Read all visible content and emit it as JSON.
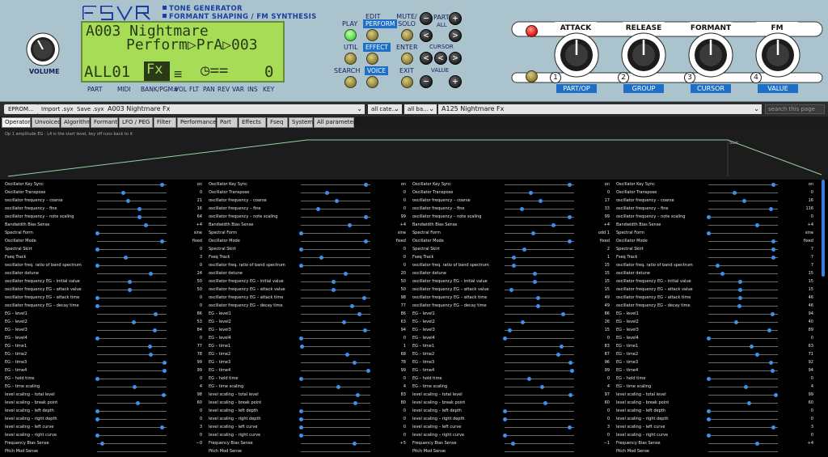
{
  "panel": {
    "logo": "FSVR",
    "subtitle1": "TONE GENERATOR",
    "subtitle2": "FORMANT SHAPING / FM  SYNTHESIS",
    "volume_label": "VOLUME",
    "lcd": {
      "line1": "A003 Nightmare",
      "line2": "Perform▷PrA▷003",
      "part": "ALL01",
      "fx": "Fx",
      "bars": "≡",
      "clock": "◷==",
      "key": "0"
    },
    "lcd_labels": [
      "PART",
      "MIDI",
      "BANK/PGM#",
      "VOL",
      "FLT",
      "PAN",
      "REV",
      "VAR",
      "INS",
      "KEY"
    ],
    "buttons": {
      "play": "PLAY",
      "edit": "EDIT",
      "perform": "PERFORM",
      "util": "UTIL",
      "effect": "EFFECT",
      "search": "SEARCH",
      "voice": "VOICE",
      "mute_solo": "MUTE/\nSOLO",
      "enter": "ENTER",
      "exit": "EXIT",
      "part": "PART",
      "all": "ALL",
      "cursor": "CURSOR",
      "value": "VALUE",
      "minus": "−",
      "plus": "+",
      "lt": "<",
      "gt": ">"
    },
    "knobs": [
      {
        "label": "ATTACK",
        "num": "1",
        "bottom": "PART/OP"
      },
      {
        "label": "RELEASE",
        "num": "2",
        "bottom": "GROUP"
      },
      {
        "label": "FORMANT",
        "num": "3",
        "bottom": "CURSOR"
      },
      {
        "label": "FM",
        "num": "4",
        "bottom": "VALUE"
      }
    ],
    "colors": {
      "panel": "#abc3cc",
      "lcd": "#a7dc56",
      "accent": "#1e6fc8"
    }
  },
  "toolbar": {
    "eprom": "EPROM...",
    "import": "Import .syx",
    "save": "Save .syx",
    "program": "A003  Nightmare  Fx",
    "category": "all cate...",
    "bank": "all ba...",
    "preset": "A125  Nightmare  Fx",
    "search_placeholder": "search this page"
  },
  "tabs": [
    "Operators",
    "Unvoiced",
    "Algorithm",
    "Formant",
    "LFO / PEG",
    "Filter",
    "Performance",
    "Part",
    "Effects",
    "Fseq",
    "System",
    "All parameters"
  ],
  "active_tab": "Operators",
  "eg": {
    "title": "Op 1 amplitude EG : L4 is the start level, key off runs back to it",
    "sustain_label": "Sust"
  },
  "param_names": [
    "Oscillator Key Sync",
    "Oscillator Transpose",
    "oscillator frequency – coarse",
    "oscillator frequency – fine",
    "oscillator frequency – note scaling",
    "Bandwidth Bias Sense",
    "Spectral Form",
    "Oscillator Mode",
    "Spectral Skirt",
    "Fseq Track",
    "oscillator freq. ratio of band spectrum",
    "oscillator detune",
    "oscillator frequency EG – initial value",
    "oscillator frequency EG – attack value",
    "oscillator frequency EG – attack time",
    "oscillator frequency EG – decay time",
    "EG – level1",
    "EG – level2",
    "EG – level3",
    "EG – level4",
    "EG – time1",
    "EG – time2",
    "EG – time3",
    "EG – time4",
    "EG – hold time",
    "EG – time scaling",
    "level scaling – total level",
    "level scaling – break point",
    "level scaling – left depth",
    "level scaling – right depth",
    "level scaling – left curve",
    "level scaling – right curve",
    "Frequency Bias Sense",
    "Pitch Mod Sense"
  ],
  "operators": [
    {
      "values": [
        "on",
        "0",
        "21",
        "16",
        "64",
        "+4",
        "sine",
        "fixed",
        "0",
        "3",
        "0",
        "24",
        "50",
        "50",
        "0",
        "0",
        "86",
        "53",
        "84",
        "0",
        "77",
        "78",
        "99",
        "99",
        "0",
        "4",
        "98",
        "60",
        "0",
        "0",
        "3",
        "0",
        "−0",
        ""
      ],
      "levels": [
        0.95,
        0.38,
        0.45,
        0.62,
        0.62,
        0.72,
        0.0,
        0.95,
        0.0,
        0.42,
        0.0,
        0.78,
        0.48,
        0.48,
        0.0,
        0.0,
        0.86,
        0.53,
        0.84,
        0.0,
        0.77,
        0.78,
        0.99,
        0.99,
        0.0,
        0.55,
        0.98,
        0.6,
        0.0,
        0.0,
        0.95,
        0.0,
        0.07,
        null
      ]
    },
    {
      "values": [
        "on",
        "0",
        "0",
        "0",
        "99",
        "+4",
        "sine",
        "fixed",
        "0",
        "0",
        "0",
        "20",
        "50",
        "50",
        "98",
        "77",
        "86",
        "63",
        "94",
        "0",
        "1",
        "68",
        "78",
        "99",
        "0",
        "4",
        "83",
        "80",
        "0",
        "0",
        "0",
        "0",
        "+5",
        ""
      ],
      "levels": [
        0.95,
        0.38,
        0.52,
        0.25,
        0.95,
        0.72,
        0.0,
        0.95,
        0.0,
        0.3,
        0.0,
        0.65,
        0.48,
        0.48,
        0.93,
        0.75,
        0.86,
        0.63,
        0.94,
        0.0,
        0.01,
        0.68,
        0.78,
        0.99,
        0.0,
        0.55,
        0.83,
        0.8,
        0.0,
        0.0,
        0.0,
        0.0,
        0.78,
        null
      ]
    },
    {
      "values": [
        "on",
        "0",
        "17",
        "33",
        "99",
        "+4",
        "odd 1",
        "fixed",
        "2",
        "1",
        "15",
        "15",
        "15",
        "15",
        "49",
        "49",
        "86",
        "26",
        "15",
        "0",
        "83",
        "87",
        "96",
        "99",
        "0",
        "4",
        "97",
        "60",
        "0",
        "0",
        "3",
        "0",
        "−1",
        ""
      ],
      "levels": [
        0.95,
        0.38,
        0.52,
        0.25,
        0.95,
        0.72,
        0.42,
        0.95,
        0.28,
        0.13,
        0.13,
        0.44,
        0.44,
        0.1,
        0.49,
        0.49,
        0.86,
        0.26,
        0.07,
        0.0,
        0.83,
        0.79,
        0.96,
        0.99,
        0.36,
        0.55,
        0.97,
        0.6,
        0.0,
        0.0,
        0.95,
        0.0,
        0.12,
        null
      ]
    },
    {
      "values": [
        "on",
        "0",
        "16",
        "116",
        "0",
        "+4",
        "sine",
        "fixed",
        "7",
        "7",
        "7",
        "15",
        "15",
        "15",
        "46",
        "46",
        "94",
        "40",
        "89",
        "0",
        "63",
        "71",
        "92",
        "94",
        "0",
        "4",
        "99",
        "60",
        "0",
        "0",
        "3",
        "0",
        "+4",
        ""
      ],
      "levels": [
        0.95,
        0.38,
        0.52,
        0.92,
        0.0,
        0.72,
        0.0,
        0.95,
        0.95,
        0.95,
        0.13,
        0.2,
        0.46,
        0.46,
        0.46,
        0.45,
        0.94,
        0.4,
        0.89,
        0.0,
        0.63,
        0.71,
        0.92,
        0.94,
        0.0,
        0.55,
        0.99,
        0.6,
        0.0,
        0.0,
        0.95,
        0.0,
        0.72,
        null
      ]
    }
  ]
}
